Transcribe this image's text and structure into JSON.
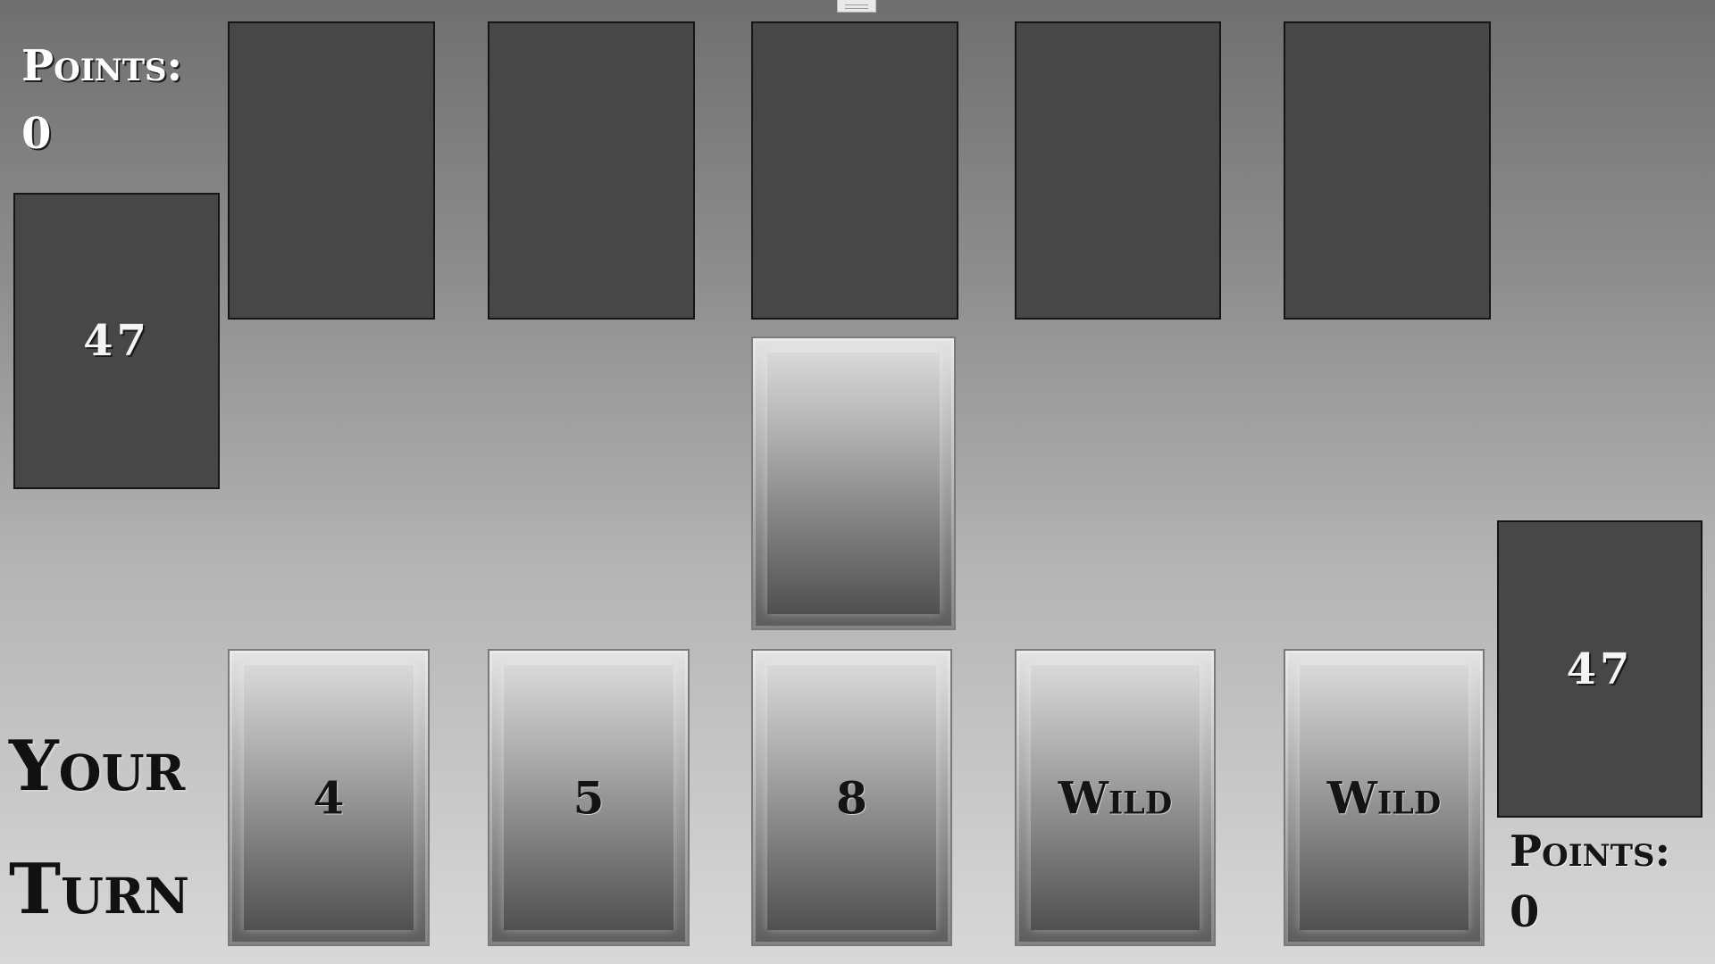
{
  "opponent": {
    "points_label": "Points:",
    "points_value": "0",
    "deck_count": "47",
    "hand_cards": 5
  },
  "player": {
    "points_label": "Points:",
    "points_value": "0",
    "deck_count": "47",
    "hand": [
      {
        "label": "4"
      },
      {
        "label": "5"
      },
      {
        "label": "8"
      },
      {
        "label": "Wild"
      },
      {
        "label": "Wild"
      }
    ]
  },
  "turn": {
    "line1": "Your",
    "line2": "Turn"
  },
  "colors": {
    "card_back": "#474747",
    "card_border": "#151515",
    "background_top": "#6f6f6f",
    "background_bottom": "#d8d8d8"
  }
}
